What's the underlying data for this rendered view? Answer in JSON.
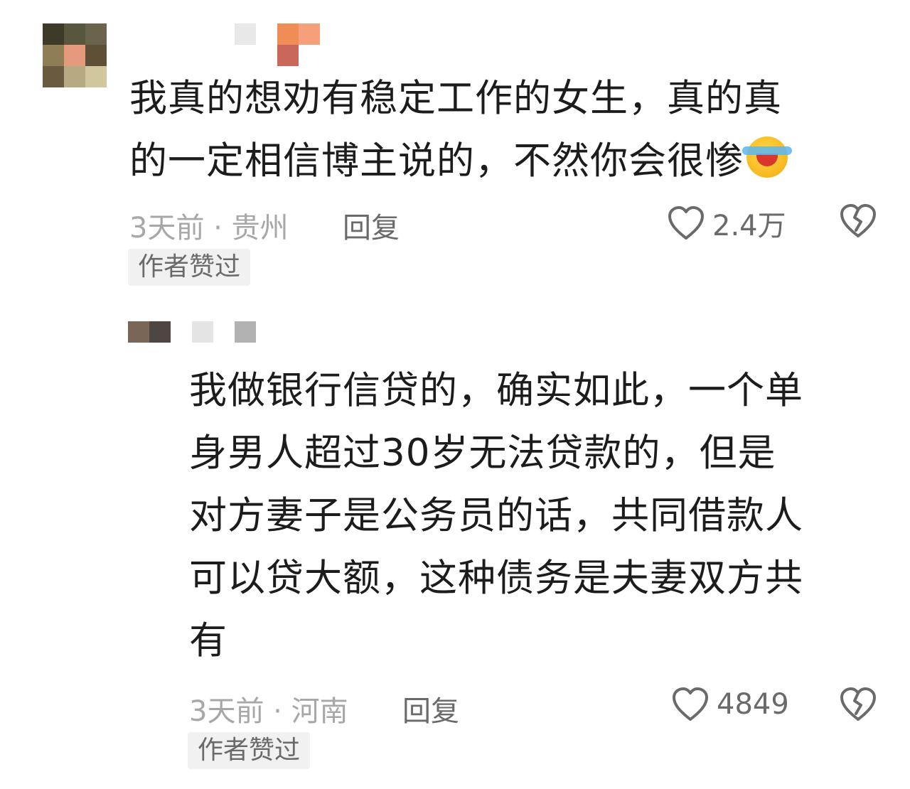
{
  "comments": [
    {
      "lines": [
        "我真的想劝有稳定工作的女生，真的真",
        "的一定相信博主说的，不然你会很惨"
      ],
      "emoji": "laughing-crying-emoji",
      "meta": "3天前 · 贵州",
      "reply": "回复",
      "likes": "2.4万",
      "badge": "作者赞过"
    },
    {
      "lines": [
        "我做银行信贷的，确实如此，一个单",
        "身男人超过30岁无法贷款的，但是",
        "对方妻子是公务员的话，共同借款人",
        "可以贷大额，这种债务是夫妻双方共",
        "有"
      ],
      "meta": "3天前 · 河南",
      "reply": "回复",
      "likes": "4849",
      "badge": "作者赞过"
    }
  ],
  "colors": {
    "text": "#1c1c1c",
    "meta": "#a7a7a7",
    "action": "#6a6a6a",
    "badge_bg": "#f1f1f1"
  },
  "icons": [
    "heart-outline-icon",
    "broken-heart-icon"
  ]
}
